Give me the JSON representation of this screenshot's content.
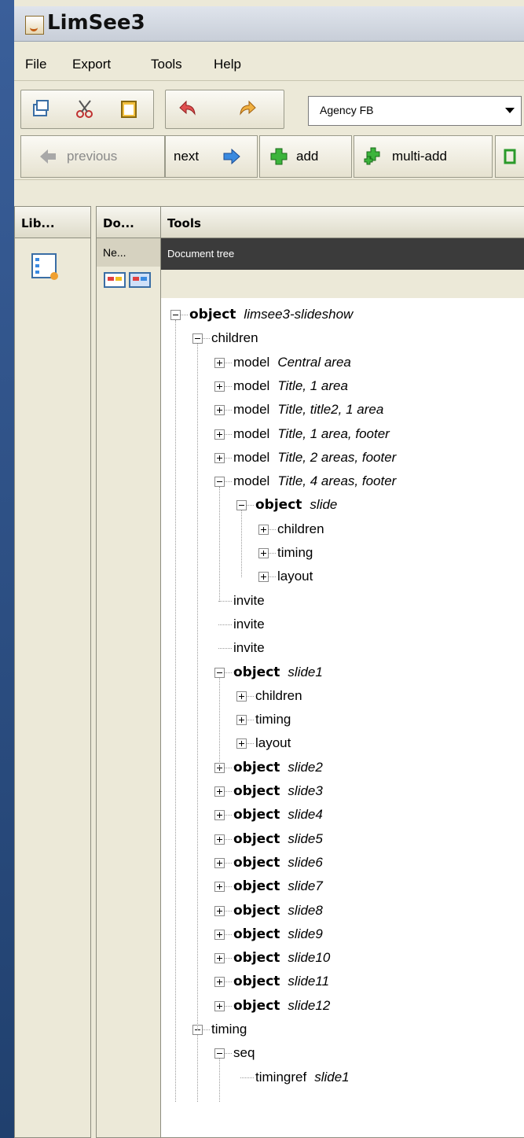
{
  "window": {
    "title": "LimSee3"
  },
  "menu": [
    {
      "label": "File"
    },
    {
      "label": "Export"
    },
    {
      "label": "Tools"
    },
    {
      "label": "Help"
    }
  ],
  "toolbar": {
    "font_value": "Agency FB"
  },
  "nav": {
    "previous": "previous",
    "next": "next",
    "add": "add",
    "multi_add": "multi-add"
  },
  "panels": {
    "lib": {
      "header": "Lib..."
    },
    "doc": {
      "header": "Do...",
      "item": "Ne..."
    },
    "tools": {
      "header": "Tools",
      "subheader": "Document tree"
    }
  },
  "tree": [
    {
      "kw": "object",
      "name": "limsee3-slideshow",
      "bold": true
    },
    {
      "text": "children"
    },
    {
      "text": "model",
      "name": "Central area"
    },
    {
      "text": "model",
      "name": "Title, 1 area"
    },
    {
      "text": "model",
      "name": "Title, title2, 1 area"
    },
    {
      "text": "model",
      "name": "Title, 1 area, footer"
    },
    {
      "text": "model",
      "name": "Title, 2 areas, footer"
    },
    {
      "text": "model",
      "name": "Title, 4 areas, footer"
    },
    {
      "kw": "object",
      "name": "slide",
      "bold": true
    },
    {
      "text": "children"
    },
    {
      "text": "timing"
    },
    {
      "text": "layout"
    },
    {
      "text": "invite"
    },
    {
      "text": "invite"
    },
    {
      "text": "invite"
    },
    {
      "kw": "object",
      "name": "slide1",
      "bold": true
    },
    {
      "text": "children"
    },
    {
      "text": "timing"
    },
    {
      "text": "layout"
    },
    {
      "kw": "object",
      "name": "slide2",
      "bold": true
    },
    {
      "kw": "object",
      "name": "slide3",
      "bold": true
    },
    {
      "kw": "object",
      "name": "slide4",
      "bold": true
    },
    {
      "kw": "object",
      "name": "slide5",
      "bold": true
    },
    {
      "kw": "object",
      "name": "slide6",
      "bold": true
    },
    {
      "kw": "object",
      "name": "slide7",
      "bold": true
    },
    {
      "kw": "object",
      "name": "slide8",
      "bold": true
    },
    {
      "kw": "object",
      "name": "slide9",
      "bold": true
    },
    {
      "kw": "object",
      "name": "slide10",
      "bold": true
    },
    {
      "kw": "object",
      "name": "slide11",
      "bold": true
    },
    {
      "kw": "object",
      "name": "slide12",
      "bold": true
    },
    {
      "text": "timing"
    },
    {
      "text": "seq"
    },
    {
      "text": "timingref",
      "name": "slide1"
    }
  ]
}
